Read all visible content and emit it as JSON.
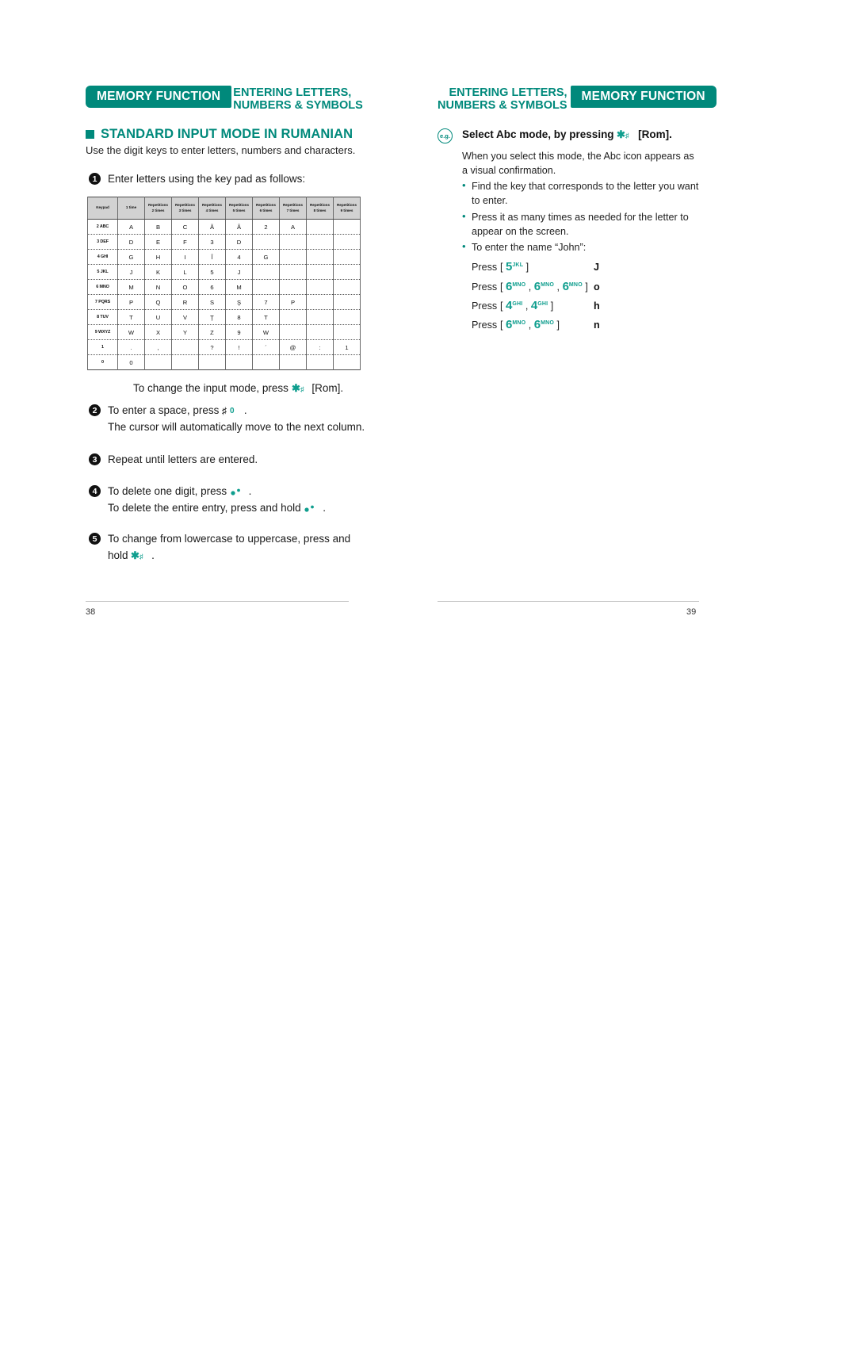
{
  "left_page": {
    "running_head": {
      "badge": "MEMORY FUNCTION",
      "title_line1": "ENTERING LETTERS,",
      "title_line2": "NUMBERS & SYMBOLS"
    },
    "section_heading": "STANDARD INPUT MODE IN RUMANIAN",
    "section_subtitle": "Use the digit keys to enter letters, numbers and characters.",
    "steps": [
      {
        "num": "1",
        "lines": [
          "Enter letters using the key pad as follows:"
        ]
      },
      {
        "num": "2",
        "lines": [
          "To enter a space, press",
          "The cursor will automatically move to the next column."
        ]
      },
      {
        "num": "3",
        "lines": [
          "Repeat until letters are entered."
        ]
      },
      {
        "num": "4",
        "lines": [
          "To delete one digit, press",
          "To delete the entire entry, press and hold"
        ]
      },
      {
        "num": "5",
        "lines": [
          "To change from lowercase to uppercase, press and",
          "hold"
        ]
      }
    ],
    "after_table_text_pre": "To change the input mode, press",
    "after_table_text_post": "[Rom].",
    "step2_line1_pre": "To enter a space, press",
    "step2_line1_post": ".",
    "step2_line2": "The cursor will automatically move to the next column.",
    "step3_text": "Repeat until letters are entered.",
    "step4_line1_pre": "To delete one digit, press",
    "step4_line1_post": ".",
    "step4_line2_pre": "To delete the entire entry, press and hold",
    "step4_line2_post": ".",
    "step5_line1": "To change from lowercase to uppercase, press and",
    "step5_line2_pre": "hold",
    "step5_line2_post": ".",
    "folio": "38",
    "table": {
      "headers": [
        "Keypad",
        "1 time",
        "Repetitions\n2 times",
        "Repetitions\n3 times",
        "Repetitions\n4 times",
        "Repetitions\n5 times",
        "Repetitions\n6 times",
        "Repetitions\n7 times",
        "Repetitions\n8 times",
        "Repetitions\n9 times"
      ],
      "rows": [
        {
          "key": "2 ABC",
          "cells": [
            "A",
            "B",
            "C",
            "Ă",
            "Â",
            "2",
            "A",
            "",
            ""
          ]
        },
        {
          "key": "3 DEF",
          "cells": [
            "D",
            "E",
            "F",
            "3",
            "D",
            "",
            "",
            "",
            ""
          ]
        },
        {
          "key": "4 GHI",
          "cells": [
            "G",
            "H",
            "I",
            "Î",
            "4",
            "G",
            "",
            "",
            ""
          ]
        },
        {
          "key": "5 JKL",
          "cells": [
            "J",
            "K",
            "L",
            "5",
            "J",
            "",
            "",
            "",
            ""
          ]
        },
        {
          "key": "6 MNO",
          "cells": [
            "M",
            "N",
            "O",
            "6",
            "M",
            "",
            "",
            "",
            ""
          ]
        },
        {
          "key": "7 PQRS",
          "cells": [
            "P",
            "Q",
            "R",
            "S",
            "Ş",
            "7",
            "P",
            "",
            ""
          ]
        },
        {
          "key": "8 TUV",
          "cells": [
            "T",
            "U",
            "V",
            "Ţ",
            "8",
            "T",
            "",
            "",
            ""
          ]
        },
        {
          "key": "9 WXYZ",
          "cells": [
            "W",
            "X",
            "Y",
            "Z",
            "9",
            "W",
            "",
            "",
            ""
          ]
        },
        {
          "key": "1",
          "cells": [
            ".",
            ",",
            "",
            "?",
            "!",
            "´",
            "@",
            ":",
            "1"
          ]
        },
        {
          "key": "0",
          "cells": [
            "0",
            "",
            "",
            "",
            "",
            "",
            "",
            "",
            ""
          ]
        }
      ]
    }
  },
  "right_page": {
    "running_head": {
      "badge": "MEMORY FUNCTION",
      "title_line1": "ENTERING LETTERS,",
      "title_line2": "NUMBERS & SYMBOLS"
    },
    "example_marker": "e.g.",
    "example_title_pre": "Select Abc mode, by pressing",
    "example_title_post": "[Rom].",
    "example_paragraph": "When you select this mode, the Abc icon appears as a visual confirmation.",
    "bullets": [
      "Find the key that corresponds to the letter you want to enter.",
      "Press it as many times as needed for the letter to appear on the screen.",
      "To enter the name “John”:"
    ],
    "press_rows": [
      {
        "label": "Press",
        "keys": [
          {
            "digit": "5",
            "sub": "JKL"
          }
        ],
        "result": "J"
      },
      {
        "label": "Press",
        "keys": [
          {
            "digit": "6",
            "sub": "MNO"
          },
          {
            "digit": "6",
            "sub": "MNO"
          },
          {
            "digit": "6",
            "sub": "MNO"
          }
        ],
        "result": "o"
      },
      {
        "label": "Press",
        "keys": [
          {
            "digit": "4",
            "sub": "GHI"
          },
          {
            "digit": "4",
            "sub": "GHI"
          }
        ],
        "result": "h"
      },
      {
        "label": "Press",
        "keys": [
          {
            "digit": "6",
            "sub": "MNO"
          },
          {
            "digit": "6",
            "sub": "MNO"
          }
        ],
        "result": "n"
      }
    ],
    "folio": "39"
  },
  "icons": {
    "star_rom": "star-rom-key-icon",
    "hash_zero": "hash-key-icon",
    "clear_dots": "clear-key-icon"
  },
  "colors": {
    "accent": "#00897b",
    "accent_light": "#0f9e8e",
    "header_fill": "#d2d2d2",
    "rule": "#bdbdbd"
  }
}
